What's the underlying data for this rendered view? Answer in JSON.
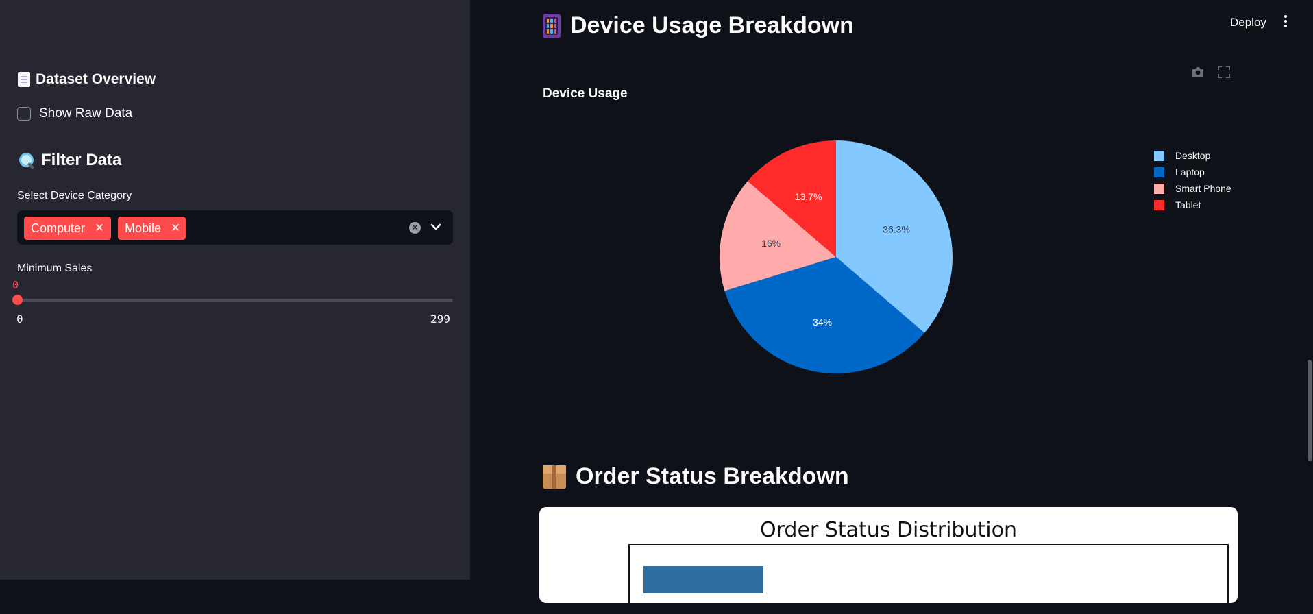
{
  "sidebar": {
    "dataset_heading": "Dataset Overview",
    "show_raw_label": "Show Raw Data",
    "filter_heading": "Filter Data",
    "device_category_label": "Select Device Category",
    "selected_tags": [
      "Computer",
      "Mobile"
    ],
    "min_sales_label": "Minimum Sales",
    "min_sales_value": "0",
    "slider_min": "0",
    "slider_max": "299"
  },
  "header": {
    "deploy_label": "Deploy"
  },
  "main": {
    "device_title": "Device Usage Breakdown",
    "device_chart_title": "Device Usage",
    "order_title": "Order Status Breakdown",
    "order_chart_title": "Order Status Distribution"
  },
  "colors": {
    "accent": "#ff4b4b",
    "desktop": "#83c9ff",
    "laptop": "#0068c9",
    "smart_phone": "#ffabab",
    "tablet": "#ff2b2b"
  },
  "chart_data": [
    {
      "type": "pie",
      "title": "Device Usage",
      "categories": [
        "Desktop",
        "Laptop",
        "Smart Phone",
        "Tablet"
      ],
      "values": [
        36.3,
        34,
        16,
        13.7
      ],
      "labels": [
        "36.3%",
        "34%",
        "16%",
        "13.7%"
      ],
      "colors": [
        "#83c9ff",
        "#0068c9",
        "#ffabab",
        "#ff2b2b"
      ],
      "legend": "top-right"
    }
  ]
}
